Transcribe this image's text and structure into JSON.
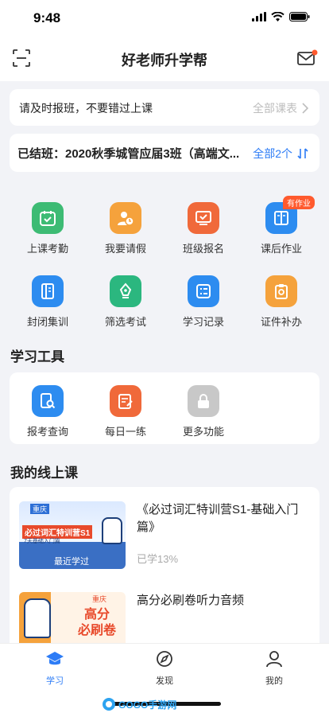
{
  "status": {
    "time": "9:48"
  },
  "header": {
    "title": "好老师升学帮"
  },
  "notice": {
    "text": "请及时报班，不要错过上课",
    "link": "全部课表"
  },
  "class_bar": {
    "text": "已结班：2020秋季城管应届3班（高端文...",
    "all_label": "全部2个"
  },
  "features": [
    {
      "label": "上课考勤",
      "icon": "calendar-check-icon",
      "color": "#3dbb74"
    },
    {
      "label": "我要请假",
      "icon": "user-clock-icon",
      "color": "#f5a23c"
    },
    {
      "label": "班级报名",
      "icon": "monitor-check-icon",
      "color": "#f0693a"
    },
    {
      "label": "课后作业",
      "icon": "book-icon",
      "color": "#2d8cf0",
      "badge": "有作业"
    },
    {
      "label": "封闭集训",
      "icon": "notebook-icon",
      "color": "#2d8cf0"
    },
    {
      "label": "筛选考试",
      "icon": "pen-nib-icon",
      "color": "#2bb77f"
    },
    {
      "label": "学习记录",
      "icon": "list-record-icon",
      "color": "#2d8cf0"
    },
    {
      "label": "证件补办",
      "icon": "certificate-icon",
      "color": "#f5a23c"
    }
  ],
  "tools": {
    "title": "学习工具",
    "items": [
      {
        "label": "报考查询",
        "icon": "search-doc-icon",
        "color": "#2d8cf0"
      },
      {
        "label": "每日一练",
        "icon": "practice-icon",
        "color": "#f0693a"
      },
      {
        "label": "更多功能",
        "icon": "lock-icon",
        "color": "#c8c8c8"
      }
    ]
  },
  "courses": {
    "title": "我的线上课",
    "items": [
      {
        "title": "《必过词汇特训营S1-基础入门篇》",
        "progress": "已学13%",
        "thumb": {
          "city": "重庆",
          "headline": "必过词汇特训营S1",
          "sub": "7天基础入门篇",
          "tag": "最近学过"
        }
      },
      {
        "title": "高分必刷卷听力音频",
        "progress": "",
        "thumb": {
          "city": "重庆",
          "headline": "高分",
          "headline2": "必刷卷"
        }
      }
    ]
  },
  "tabbar": {
    "items": [
      {
        "label": "学习",
        "icon": "graduation-cap-icon",
        "active": true
      },
      {
        "label": "发现",
        "icon": "compass-icon",
        "active": false
      },
      {
        "label": "我的",
        "icon": "person-icon",
        "active": false
      }
    ]
  },
  "watermark": {
    "text": "GOGO手游网"
  },
  "colors": {
    "accent": "#2d7cf6",
    "background": "#f2f3f7",
    "badge": "#ff5a2e"
  }
}
